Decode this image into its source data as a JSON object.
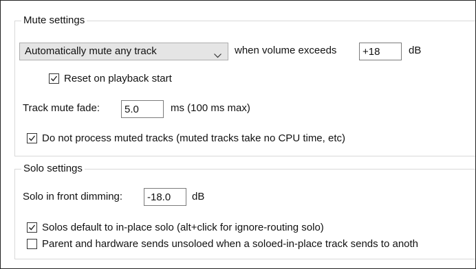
{
  "mute_settings": {
    "title": "Mute settings",
    "auto_mute_dropdown": {
      "selected": "Automatically mute any track"
    },
    "when_volume_label": "when volume exceeds",
    "volume_threshold_value": "+18",
    "volume_unit": "dB",
    "reset_on_playback": {
      "label": "Reset on playback start",
      "checked": true
    },
    "track_mute_fade_label": "Track mute fade:",
    "track_mute_fade_value": "5.0",
    "track_mute_fade_unit": "ms (100 ms max)",
    "do_not_process_muted": {
      "label": "Do not process muted tracks (muted tracks take no CPU time, etc)",
      "checked": true
    }
  },
  "solo_settings": {
    "title": "Solo settings",
    "solo_dimming_label": "Solo in front dimming:",
    "solo_dimming_value": "-18.0",
    "solo_dimming_unit": "dB",
    "solos_default_in_place": {
      "label": "Solos default to in-place solo (alt+click for ignore-routing solo)",
      "checked": true
    },
    "parent_hardware_sends_unsoloed": {
      "label": "Parent and hardware sends unsoloed when a soloed-in-place track sends to anoth",
      "checked": false
    }
  },
  "icons": {
    "dropdown": "chevron-down-icon",
    "check": "checkmark-icon"
  },
  "colors": {
    "group_border": "#d8d8d8",
    "dropdown_bg": "#e5e5e5",
    "frame_border": "#222222"
  }
}
